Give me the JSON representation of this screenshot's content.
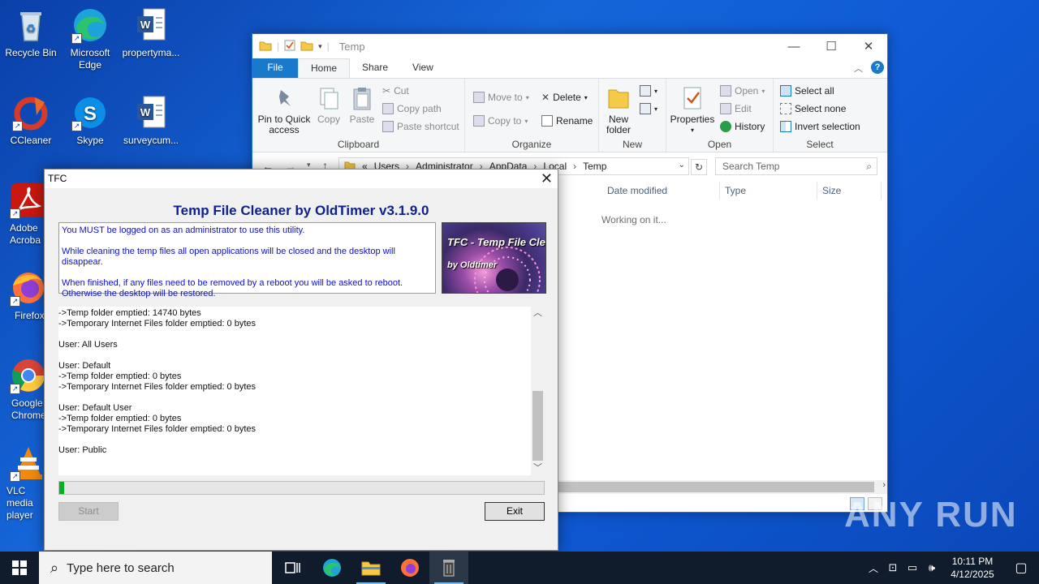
{
  "desktop": {
    "icons": [
      {
        "label": "Recycle Bin"
      },
      {
        "label": "Microsoft Edge"
      },
      {
        "label": "propertyma..."
      },
      {
        "label": "CCleaner"
      },
      {
        "label": "Skype"
      },
      {
        "label": "surveycum..."
      },
      {
        "label": "Adobe Acroba"
      },
      {
        "label": "Firefox"
      },
      {
        "label": "Google Chrome"
      },
      {
        "label": "VLC media player"
      }
    ]
  },
  "explorer": {
    "title": "Temp",
    "tabs": [
      "File",
      "Home",
      "Share",
      "View"
    ],
    "ribbon": {
      "clipboard": {
        "label": "Clipboard",
        "pin": "Pin to Quick access",
        "copy": "Copy",
        "paste": "Paste",
        "cut": "Cut",
        "copy_path": "Copy path",
        "paste_shortcut": "Paste shortcut"
      },
      "organize": {
        "label": "Organize",
        "move_to": "Move to",
        "copy_to": "Copy to",
        "delete": "Delete",
        "rename": "Rename"
      },
      "new": {
        "label": "New",
        "new_folder": "New folder"
      },
      "open": {
        "label": "Open",
        "properties": "Properties",
        "open": "Open",
        "edit": "Edit",
        "history": "History"
      },
      "select": {
        "label": "Select",
        "select_all": "Select all",
        "select_none": "Select none",
        "invert": "Invert selection"
      }
    },
    "address": {
      "prefix": "«",
      "crumbs": [
        "Users",
        "Administrator",
        "AppData",
        "Local",
        "Temp"
      ]
    },
    "search_placeholder": "Search Temp",
    "columns": [
      "Date modified",
      "Type",
      "Size"
    ],
    "status": "Working on it..."
  },
  "tfc": {
    "window_title": "TFC",
    "heading": "Temp File Cleaner by OldTimer v3.1.9.0",
    "notice": [
      "You MUST be logged on as an administrator to use this utility.",
      "While cleaning the temp files all open applications will be closed and the desktop will disappear.",
      "When finished, if any files need to be removed by a reboot you will be asked to reboot.",
      "Otherwise the desktop will be restored."
    ],
    "logo_line1": "TFC - Temp File Cleaner",
    "logo_line2": "by Oldtimer",
    "log_lines": [
      "->Temp folder emptied: 14740 bytes",
      "->Temporary Internet Files folder emptied: 0 bytes",
      "",
      "User: All Users",
      "",
      "User: Default",
      "->Temp folder emptied: 0 bytes",
      "->Temporary Internet Files folder emptied: 0 bytes",
      "",
      "User: Default User",
      "->Temp folder emptied: 0 bytes",
      "->Temporary Internet Files folder emptied: 0 bytes",
      "",
      "User: Public"
    ],
    "progress_fraction": 0.01,
    "start_label": "Start",
    "exit_label": "Exit"
  },
  "taskbar": {
    "search_placeholder": "Type here to search",
    "time": "10:11 PM",
    "date": "4/12/2025"
  },
  "watermark": "ANY RUN"
}
